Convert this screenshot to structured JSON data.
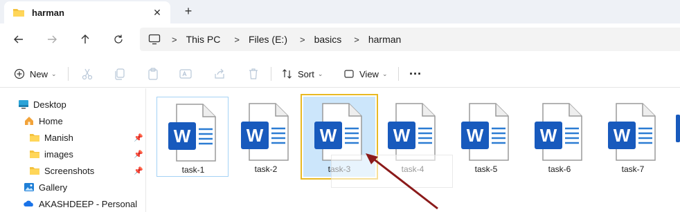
{
  "tab": {
    "title": "harman",
    "close_label": "✕",
    "new_tab_label": "+"
  },
  "nav": {
    "back_icon": "back-arrow-icon",
    "forward_icon": "forward-arrow-icon",
    "up_icon": "up-arrow-icon",
    "refresh_icon": "refresh-icon"
  },
  "breadcrumb": {
    "items": [
      "This PC",
      "Files (E:)",
      "basics",
      "harman"
    ],
    "separator": ">"
  },
  "toolbar": {
    "new_label": "New",
    "sort_label": "Sort",
    "view_label": "View",
    "more_label": "···"
  },
  "sidebar": {
    "items": [
      {
        "label": "Desktop",
        "icon": "desktop-icon"
      },
      {
        "label": "Home",
        "icon": "home-icon"
      },
      {
        "label": "Manish",
        "icon": "folder-icon",
        "pinned": true
      },
      {
        "label": "images",
        "icon": "folder-icon",
        "pinned": true
      },
      {
        "label": "Screenshots",
        "icon": "folder-icon",
        "pinned": true
      },
      {
        "label": "Gallery",
        "icon": "gallery-icon"
      },
      {
        "label": "AKASHDEEP - Personal",
        "icon": "onedrive-icon"
      }
    ]
  },
  "files": [
    {
      "name": "task-1",
      "state": "selected"
    },
    {
      "name": "task-2",
      "state": "normal"
    },
    {
      "name": "task-3",
      "state": "focused"
    },
    {
      "name": "task-4",
      "state": "normal"
    },
    {
      "name": "task-5",
      "state": "normal"
    },
    {
      "name": "task-6",
      "state": "normal"
    },
    {
      "name": "task-7",
      "state": "normal"
    }
  ],
  "colors": {
    "word_blue": "#185abd",
    "word_dark": "#2b7cd3",
    "focus_outline": "#e8b923",
    "selection_bg": "#cce6fb",
    "annotation_arrow": "#8b1a1a"
  }
}
